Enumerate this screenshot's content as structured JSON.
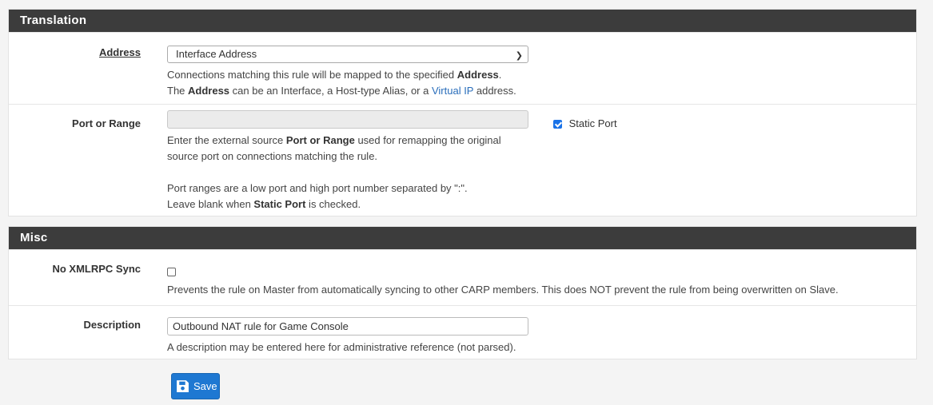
{
  "translation": {
    "heading": "Translation",
    "address": {
      "label": "Address",
      "selected": "Interface Address",
      "help_pre": "Connections matching this rule will be mapped to the specified ",
      "help_bold1": "Address",
      "help_dot": ".",
      "help_the": "The ",
      "help_bold2": "Address",
      "help_mid": " can be an Interface, a Host-type Alias, or a ",
      "help_link": "Virtual IP",
      "help_end": " address."
    },
    "port": {
      "label": "Port or Range",
      "value": "",
      "static_port_label": "Static Port",
      "static_port_checked": true,
      "help_l1_pre": "Enter the external source ",
      "help_l1_bold": "Port or Range",
      "help_l1_end": " used for remapping the original",
      "help_l2": "source port on connections matching the rule.",
      "help_l3": "Port ranges are a low port and high port number separated by \":\".",
      "help_l4_pre": "Leave blank when ",
      "help_l4_bold": "Static Port",
      "help_l4_end": " is checked."
    }
  },
  "misc": {
    "heading": "Misc",
    "xmlrpc": {
      "label": "No XMLRPC Sync",
      "checked": false,
      "help": "Prevents the rule on Master from automatically syncing to other CARP members. This does NOT prevent the rule from being overwritten on Slave."
    },
    "description": {
      "label": "Description",
      "value": "Outbound NAT rule for Game Console",
      "help": "A description may be entered here for administrative reference (not parsed)."
    }
  },
  "save_label": "Save",
  "icons": {
    "save": "floppy-disk-icon",
    "select": "chevron-down-icon",
    "checkbox_checked": "checkmark-icon"
  },
  "colors": {
    "heading_bg": "#3c3c3c",
    "link": "#2a6ebb",
    "button": "#1e78d2"
  }
}
